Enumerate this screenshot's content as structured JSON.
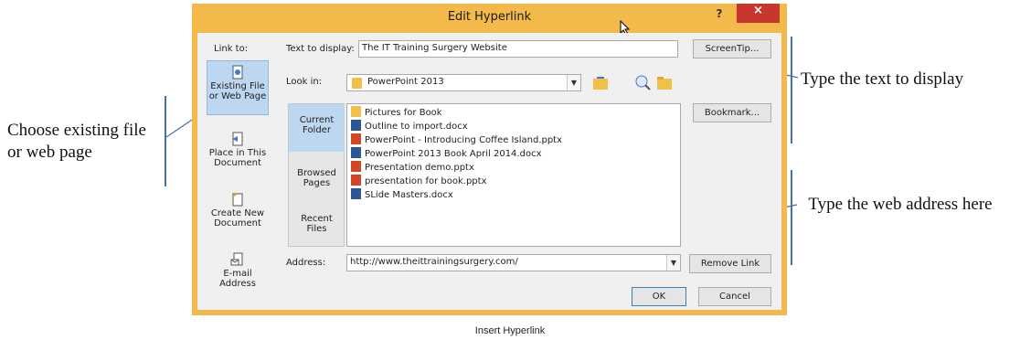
{
  "dialog": {
    "title": "Edit Hyperlink",
    "help": "?",
    "close": "×"
  },
  "link_to": {
    "header": "Link to:",
    "items": [
      {
        "label": "Existing File or Web Page",
        "icon": "existing-file-icon"
      },
      {
        "label": "Place in This Document",
        "icon": "place-in-document-icon"
      },
      {
        "label": "Create New Document",
        "icon": "new-document-icon"
      },
      {
        "label": "E-mail Address",
        "icon": "email-icon"
      }
    ]
  },
  "text_to_display": {
    "label": "Text to display:",
    "value": "The IT Training Surgery Website"
  },
  "screentip_button": "ScreenTip...",
  "look_in": {
    "label": "Look in:",
    "value": "PowerPoint 2013"
  },
  "side_tabs": [
    "Current Folder",
    "Browsed Pages",
    "Recent Files"
  ],
  "files": [
    {
      "name": "Pictures for Book",
      "type": "folder"
    },
    {
      "name": "Outline to import.docx",
      "type": "word"
    },
    {
      "name": "PowerPoint - Introducing Coffee Island.pptx",
      "type": "ppt"
    },
    {
      "name": "PowerPoint 2013 Book April 2014.docx",
      "type": "word"
    },
    {
      "name": "Presentation demo.pptx",
      "type": "ppt"
    },
    {
      "name": "presentation for book.pptx",
      "type": "ppt"
    },
    {
      "name": "SLide Masters.docx",
      "type": "word"
    }
  ],
  "bookmark_button": "Bookmark...",
  "address": {
    "label": "Address:",
    "value": "http://www.theittrainingsurgery.com/"
  },
  "remove_link_button": "Remove Link",
  "ok_button": "OK",
  "cancel_button": "Cancel",
  "annotations": {
    "choose": "Choose existing file or web page",
    "type_text": "Type the text to display",
    "type_address": "Type the web address here"
  },
  "caption": "Insert Hyperlink",
  "colors": {
    "dialog_frame": "#f3b94a",
    "close_button": "#c7372f",
    "selection": "#bdd7f1"
  }
}
